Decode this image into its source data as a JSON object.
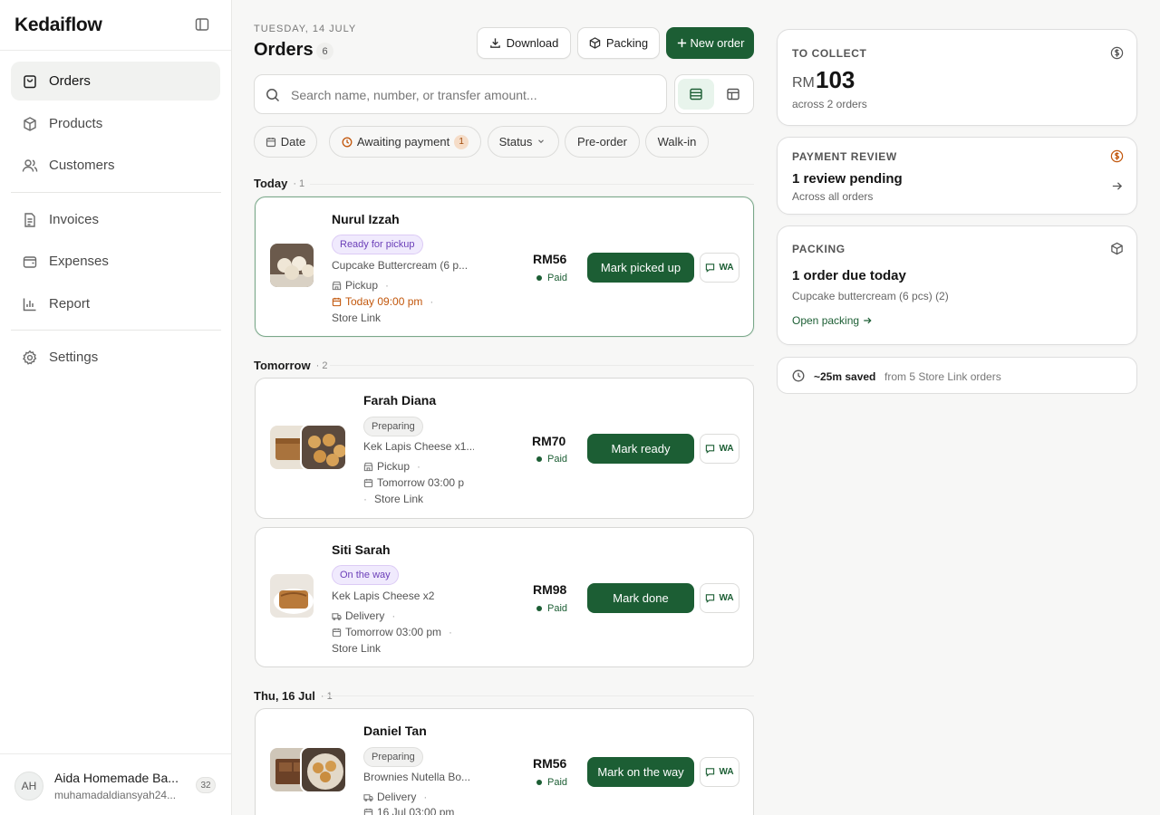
{
  "brand": "Kedaiflow",
  "nav": [
    {
      "label": "Orders"
    },
    {
      "label": "Products"
    },
    {
      "label": "Customers"
    },
    {
      "label": "Invoices"
    },
    {
      "label": "Expenses"
    },
    {
      "label": "Report"
    },
    {
      "label": "Settings"
    }
  ],
  "user": {
    "initials": "AH",
    "name": "Aida Homemade Ba...",
    "email": "muhamadaldiansyah24...",
    "badge": "32"
  },
  "header": {
    "date": "TUESDAY, 14 JULY",
    "title": "Orders",
    "count": "6"
  },
  "toolbar": {
    "download": "Download",
    "packing": "Packing",
    "new_order": "New order"
  },
  "search": {
    "placeholder": "Search name, number, or transfer amount..."
  },
  "filters": {
    "date": "Date",
    "awaiting": "Awaiting payment",
    "awaiting_count": "1",
    "status": "Status",
    "preorder": "Pre-order",
    "walkin": "Walk-in"
  },
  "groups": [
    {
      "label": "Today",
      "count": "· 1"
    },
    {
      "label": "Tomorrow",
      "count": "· 2"
    },
    {
      "label": "Thu, 16 Jul",
      "count": "· 1"
    }
  ],
  "orders": [
    {
      "name": "Nurul Izzah",
      "status": "Ready for pickup",
      "item": "Cupcake Buttercream (6 p...",
      "method": "Pickup",
      "time": "Today 09:00 pm",
      "source": "Store Link",
      "price": "RM56",
      "paid": "Paid",
      "action": "Mark picked up",
      "wa": "WA"
    },
    {
      "name": "Farah Diana",
      "status": "Preparing",
      "item": "Kek Lapis Cheese x1...",
      "method": "Pickup",
      "time": "Tomorrow 03:00 p",
      "source": "Store Link",
      "price": "RM70",
      "paid": "Paid",
      "action": "Mark ready",
      "wa": "WA"
    },
    {
      "name": "Siti Sarah",
      "status": "On the way",
      "item": "Kek Lapis Cheese x2",
      "method": "Delivery",
      "time": "Tomorrow 03:00 pm",
      "source": "Store Link",
      "price": "RM98",
      "paid": "Paid",
      "action": "Mark done",
      "wa": "WA"
    },
    {
      "name": "Daniel Tan",
      "status": "Preparing",
      "item": "Brownies Nutella Bo...",
      "method": "Delivery",
      "time": "16 Jul 03:00 pm",
      "price": "RM56",
      "paid": "Paid",
      "action": "Mark on the way",
      "wa": "WA"
    }
  ],
  "panels": {
    "collect": {
      "label": "TO COLLECT",
      "currency": "RM",
      "value": "103",
      "sub": "across 2 orders"
    },
    "review": {
      "label": "PAYMENT REVIEW",
      "headline": "1 review pending",
      "sub": "Across all orders"
    },
    "packing": {
      "label": "PACKING",
      "headline": "1 order due today",
      "sub": "Cupcake buttercream (6 pcs) (2)",
      "link": "Open packing"
    },
    "saved": {
      "strong": "~25m saved",
      "rest": "from 5 Store Link orders"
    }
  },
  "colors": {
    "accent": "#1c5e34",
    "warning": "#c2570c",
    "purple_pill": "#6b3fb8"
  }
}
